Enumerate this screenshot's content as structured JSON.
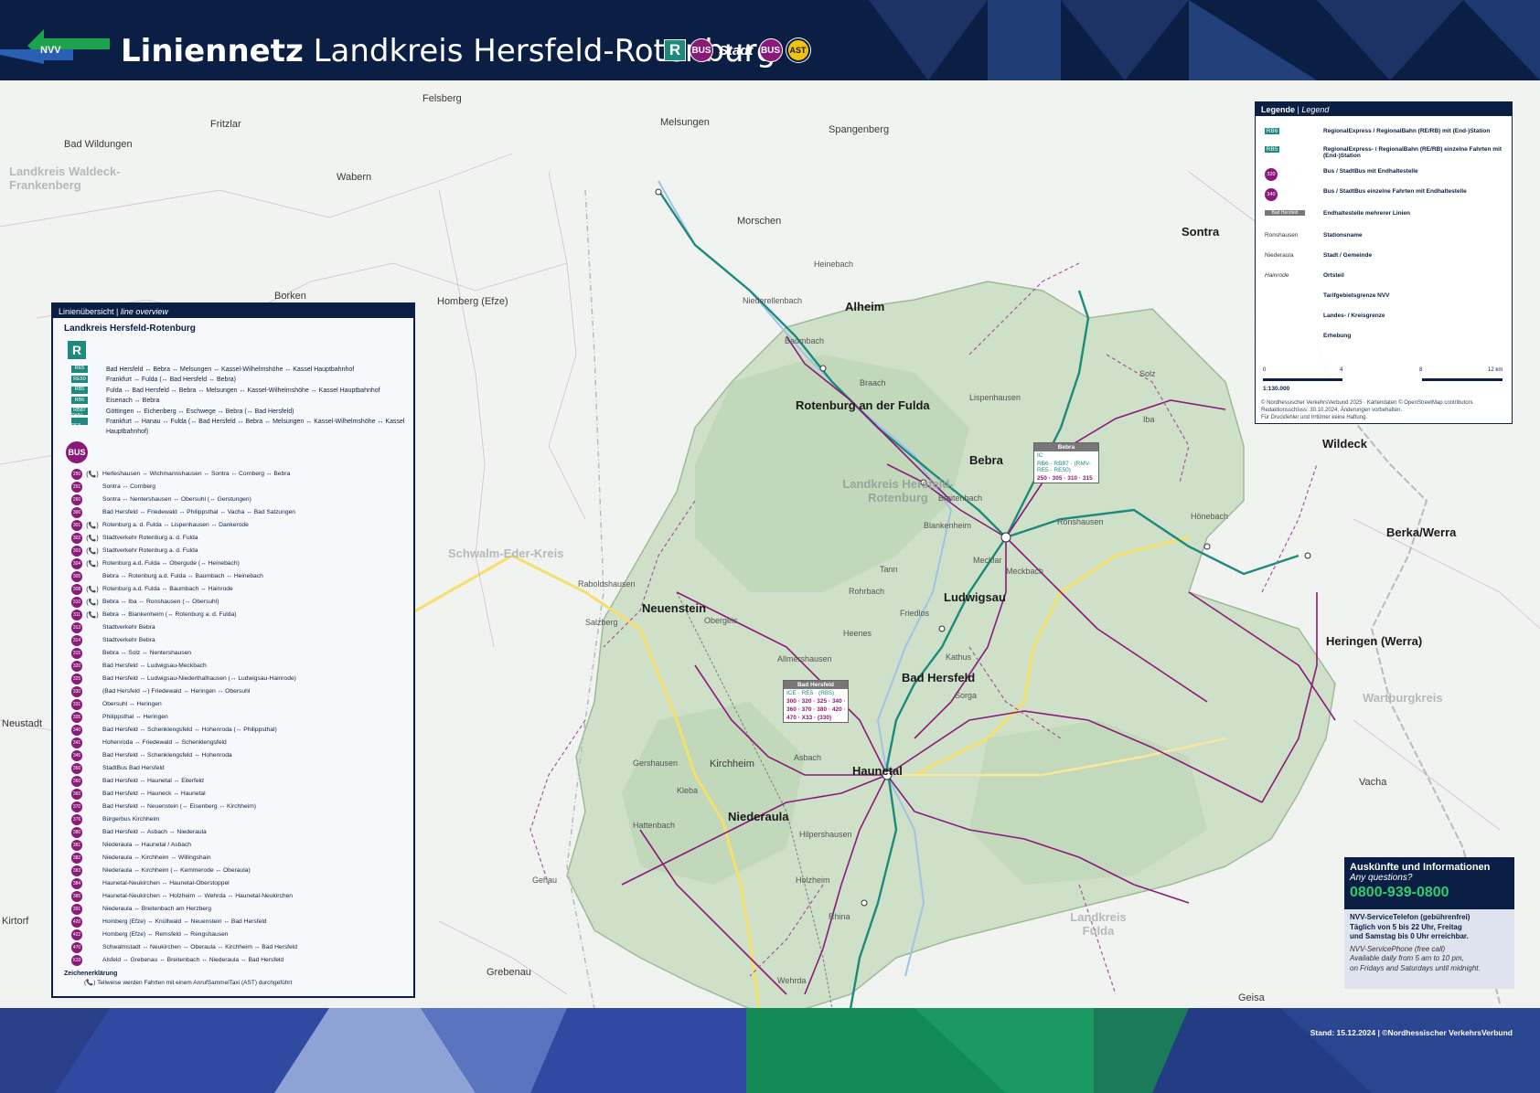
{
  "header": {
    "logo_text": "NVV",
    "title_bold": "Liniennetz",
    "title_light": "Landkreis Hersfeld-Rotenburg",
    "badge_r": "R",
    "badge_bus": "BUS",
    "badge_stadt": "Stadt",
    "badge_stadt_bus": "BUS",
    "badge_ast": "AST"
  },
  "map": {
    "places": {
      "bad_wildungen": "Bad Wildungen",
      "fritzlar": "Fritzlar",
      "waldeck": "Landkreis Waldeck-Frankenberg",
      "wabern": "Wabern",
      "felsberg": "Felsberg",
      "melsungen": "Melsungen",
      "spangenberg": "Spangenberg",
      "morschen": "Morschen",
      "borken": "Borken",
      "homberg": "Homberg (Efze)",
      "alheim": "Alheim",
      "rotenburg": "Rotenburg an der Fulda",
      "bebra": "Bebra",
      "sontra": "Sontra",
      "wildeck": "Wildeck",
      "berka": "Berka/Werra",
      "landkreis_hr": "Landkreis Hersfeld-Rotenburg",
      "schwalm": "Schwalm-Eder-Kreis",
      "neuenstein": "Neuenstein",
      "ludwigsau": "Ludwigsau",
      "bad_hersfeld": "Bad Hersfeld",
      "heringen": "Heringen (Werra)",
      "wartburgkreis": "Wartburgkreis",
      "haunetal": "Haunetal",
      "niederaula": "Niederaula",
      "kirchheim": "Kirchheim",
      "vacha": "Vacha",
      "landkreis_fulda": "Landkreis Fulda",
      "grebenau": "Grebenau",
      "geisa": "Geisa",
      "neustadt": "Neustadt",
      "kirtorf": "Kirtorf",
      "gehau": "Gehau",
      "heinebach": "Heinebach",
      "niederellenbach": "Niederellenbach",
      "baumbach": "Baumbach",
      "breitenbach": "Breitenbach",
      "friedlos": "Friedlos",
      "mecklar": "Mecklar",
      "ronshausen": "Ronshausen",
      "hoenebach": "Hönebach",
      "obergeis": "Obergeis",
      "rohrbach": "Rohrbach",
      "asbach": "Asbach",
      "kathus": "Kathus",
      "sorga": "Sorga",
      "wehrda": "Wehrda",
      "rhina": "Rhina",
      "hilpershausen": "Hilpershausen",
      "hattenbach": "Hattenbach",
      "kleba": "Kleba",
      "allmershausen": "Allmershausen",
      "solz": "Solz",
      "iba": "Iba",
      "braach": "Braach",
      "lispenhausen": "Lispenhausen",
      "tann": "Tann",
      "heenes": "Heenes",
      "salzberg": "Salzberg",
      "gershausen": "Gershausen",
      "raboldshausen": "Raboldshausen",
      "holzheim": "Holzheim",
      "meckbach": "Meckbach",
      "blankenheim": "Blankenheim"
    },
    "station_boxes": {
      "bebra": {
        "name": "Bebra",
        "rail": "IC",
        "rail2": "RB6 · RB87 · (RMV-RE5 · RE50)",
        "bus": "250 · 305 · 310 · 315"
      },
      "bad_hersfeld": {
        "name": "Bad Hersfeld",
        "rail": "ICE · RE5 · (RB5)",
        "bus1": "300 · 320 · 325 · 340 ·",
        "bus2": "360 · 370 · 380 · 420 ·",
        "bus3": "470 · X33 · (330)"
      }
    }
  },
  "overview": {
    "header": "Linienübersicht",
    "header_en": "line overview",
    "subtitle": "Landkreis Hersfeld-Rotenburg",
    "r_badge": "R",
    "rail_lines": [
      {
        "tag": "RE5",
        "text": "Bad Hersfeld ↔ Bebra ↔ Melsungen ↔ Kassel-Wilhelmshöhe ↔ Kassel Hauptbahnhof"
      },
      {
        "tag": "RE50",
        "text": "Frankfurt ↔ Fulda (↔ Bad Hersfeld ↔ Bebra)"
      },
      {
        "tag": "RB5",
        "text": "Fulda ↔ Bad Hersfeld ↔ Bebra ↔ Melsungen ↔ Kassel-Wilhelmshöhe ↔ Kassel Hauptbahnhof"
      },
      {
        "tag": "RB6",
        "text": "Eisenach ↔ Bebra"
      },
      {
        "tag": "RB87",
        "text": "Göttingen ↔ Eichenberg ↔ Eschwege ↔ Bebra (↔ Bad Hersfeld)"
      },
      {
        "tag": "RMV-RE5",
        "text": "Frankfurt ↔ Hanau ↔ Fulda (↔ Bad Hersfeld ↔ Bebra ↔ Melsungen ↔ Kassel-Wilhelmshöhe ↔ Kassel Hauptbahnhof)"
      }
    ],
    "bus_badge": "BUS",
    "bus_lines": [
      {
        "num": "250",
        "ast": true,
        "text": "Herleshausen ↔ Wichmannshausen ↔ Sontra ↔ Cornberg ↔ Bebra"
      },
      {
        "num": "251",
        "ast": false,
        "text": "Sontra ↔ Cornberg"
      },
      {
        "num": "260",
        "ast": false,
        "text": "Sontra ↔ Nentershausen ↔ Obersuhl (↔ Gerstungen)"
      },
      {
        "num": "300",
        "ast": false,
        "text": "Bad Hersfeld ↔ Friedewald ↔ Philippsthal ↔ Vacha ↔ Bad Salzungen"
      },
      {
        "num": "301",
        "ast": true,
        "text": "Rotenburg a. d. Fulda ↔ Lispenhausen ↔ Dankerode"
      },
      {
        "num": "302",
        "ast": true,
        "text": "Stadtverkehr Rotenburg a. d. Fulda"
      },
      {
        "num": "303",
        "ast": true,
        "text": "Stadtverkehr Rotenburg a. d. Fulda"
      },
      {
        "num": "304",
        "ast": true,
        "text": "Rotenburg a.d. Fulda ↔ Obergude (↔ Heinebach)"
      },
      {
        "num": "305",
        "ast": false,
        "text": "Bebra ↔ Rotenburg a.d. Fulda ↔ Baumbach ↔ Heinebach"
      },
      {
        "num": "308",
        "ast": true,
        "text": "Rotenburg a.d. Fulda ↔ Baumbach ↔ Hainrode"
      },
      {
        "num": "310",
        "ast": true,
        "text": "Bebra ↔ Iba ↔ Ronshausen (↔ Obersuhl)"
      },
      {
        "num": "311",
        "ast": true,
        "text": "Bebra ↔ Blankenheim (↔ Rotenburg a. d. Fulda)"
      },
      {
        "num": "313",
        "ast": false,
        "text": "Stadtverkehr Bebra"
      },
      {
        "num": "314",
        "ast": false,
        "text": "Stadtverkehr Bebra"
      },
      {
        "num": "315",
        "ast": false,
        "text": "Bebra ↔ Solz ↔ Nentershausen"
      },
      {
        "num": "320",
        "ast": false,
        "text": "Bad Hersfeld ↔ Ludwigsau-Meckbach"
      },
      {
        "num": "325",
        "ast": false,
        "text": "Bad Hersfeld ↔ Ludwigsau-Niederthalhausen (↔ Ludwigsau-Hainrode)"
      },
      {
        "num": "330",
        "ast": false,
        "text": "(Bad Hersfeld ↔) Friedewald ↔ Heringen ↔ Obersuhl"
      },
      {
        "num": "331",
        "ast": false,
        "text": "Obersuhl ↔ Heringen"
      },
      {
        "num": "335",
        "ast": false,
        "text": "Philippsthal ↔ Heringen"
      },
      {
        "num": "340",
        "ast": false,
        "text": "Bad Hersfeld ↔ Schenklengsfeld ↔ Hohenroda (↔ Philippsthal)"
      },
      {
        "num": "341",
        "ast": false,
        "text": "Hohenroda ↔ Friedewald ↔ Schenklengsfeld"
      },
      {
        "num": "345",
        "ast": false,
        "text": "Bad Hersfeld ↔ Schenklengsfeld ↔ Hohenroda"
      },
      {
        "num": "350",
        "ast": false,
        "text": "StadtBus Bad Hersfeld"
      },
      {
        "num": "360",
        "ast": false,
        "text": "Bad Hersfeld ↔ Haunetal ↔ Eiterfeld"
      },
      {
        "num": "365",
        "ast": false,
        "text": "Bad Hersfeld ↔ Hauneck ↔ Haunetal"
      },
      {
        "num": "370",
        "ast": false,
        "text": "Bad Hersfeld ↔ Neuenstein (↔ Eisenberg ↔ Kirchheim)"
      },
      {
        "num": "376",
        "ast": false,
        "text": "Bürgerbus Kirchheim"
      },
      {
        "num": "380",
        "ast": false,
        "text": "Bad Hersfeld ↔ Asbach ↔ Niederaula"
      },
      {
        "num": "381",
        "ast": false,
        "text": "Niederaula ↔ Haunetal / Asbach"
      },
      {
        "num": "382",
        "ast": false,
        "text": "Niederaula ↔ Kirchheim ↔ Willingshain"
      },
      {
        "num": "383",
        "ast": false,
        "text": "Niederaula ↔ Kirchheim (↔ Kemmerode ↔ Oberaula)"
      },
      {
        "num": "384",
        "ast": false,
        "text": "Haunetal-Neukirchen ↔ Haunetal-Oberstoppel"
      },
      {
        "num": "385",
        "ast": false,
        "text": "Haunetal-Neukirchen ↔ Holzheim ↔ Wehrda ↔ Haunetal-Neukirchen"
      },
      {
        "num": "391",
        "ast": false,
        "text": "Niederaula ↔ Breitenbach am Herzberg"
      },
      {
        "num": "420",
        "ast": false,
        "text": "Homberg (Efze) ↔ Knüllwald ↔ Neuenstein ↔ Bad Hersfeld"
      },
      {
        "num": "422",
        "ast": false,
        "text": "Homberg (Efze) ↔ Remsfeld ↔ Rengshausen"
      },
      {
        "num": "470",
        "ast": false,
        "text": "Schwalmstadt ↔ Neukirchen ↔ Oberaula ↔ Kirchheim ↔ Bad Hersfeld"
      },
      {
        "num": "X33",
        "ast": false,
        "text": "Alsfeld ↔ Grebenau ↔ Breitenbach ↔ Niederaula ↔ Bad Hersfeld"
      }
    ],
    "footnote_title": "Zeichenerklärung",
    "footnote_text": "Teilweise werden Fahrten mit einem AnrufSammelTaxi (AST) durchgeführt"
  },
  "legend": {
    "title": "Legende",
    "title_en": "Legend",
    "rows": [
      {
        "sym": "RB6",
        "text": "RegionalExpress / RegionalBahn (RE/RB) mit (End-)Station"
      },
      {
        "sym": "RB5",
        "text": "RegionalExpress- / RegionalBahn (RE/RB) einzelne Fahrten mit (End-)Station"
      },
      {
        "sym": "320",
        "text": "Bus / StadtBus mit Endhaltestelle"
      },
      {
        "sym": "340",
        "text": "Bus / StadtBus einzelne Fahrten mit Endhaltestelle"
      },
      {
        "sym": "Bad Hersfeld",
        "text": "Endhaltestelle mehrerer Linien"
      },
      {
        "sym": "Ronshausen",
        "text": "Stationsname"
      },
      {
        "sym": "Niederaula",
        "text": "Stadt / Gemeinde"
      },
      {
        "sym": "Hainrode",
        "text": "Ortsteil"
      },
      {
        "sym": "",
        "text": "Tarifgebietsgrenze NVV"
      },
      {
        "sym": "",
        "text": "Landes- / Kreisgrenze"
      },
      {
        "sym": "",
        "text": "Erhebung"
      }
    ],
    "scale_labels": [
      "0",
      "4",
      "8",
      "12 km"
    ],
    "scale": "1:130.000",
    "copyright": "© Nordhessischer VerkehrsVerbund 2025 · Kartendaten © OpenStreetMap contributors",
    "redaktion": "Redaktionsschluss: 30.10.2024, Änderungen vorbehalten.",
    "haftung": "Für Druckfehler und Irrtümer keine Haftung."
  },
  "info": {
    "title": "Auskünfte und Informationen",
    "title_en": "Any questions?",
    "phone": "0800-939-0800",
    "line1": "NVV-ServiceTelefon (gebührenfrei)",
    "line2": "Täglich von 5 bis 22 Uhr, Freitag",
    "line3": "und Samstag bis 0 Uhr erreichbar.",
    "en1": "NVV-ServicePhone (free call)",
    "en2": "Available daily from 5 am to 10 pm,",
    "en3": "on Fridays and Saturdays until midnight."
  },
  "footer": {
    "stand": "Stand: 15.12.2024 | ©Nordhessischer VerkehrsVerbund"
  },
  "colors": {
    "navy": "#0b1f45",
    "rail": "#1c8a7c",
    "bus": "#8a1a7a",
    "ast": "#f4c20d",
    "phone": "#2ecc71"
  }
}
